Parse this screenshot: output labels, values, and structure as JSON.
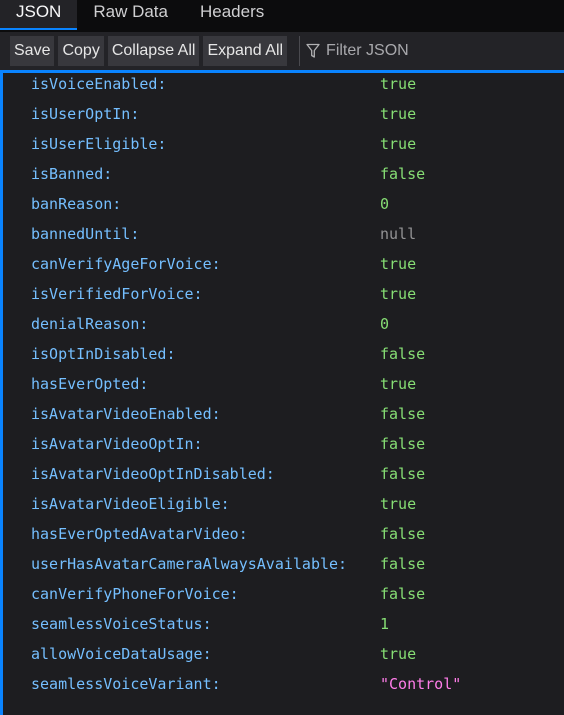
{
  "tabs": [
    {
      "label": "JSON",
      "active": true
    },
    {
      "label": "Raw Data",
      "active": false
    },
    {
      "label": "Headers",
      "active": false
    }
  ],
  "toolbar": {
    "save_label": "Save",
    "copy_label": "Copy",
    "collapse_label": "Collapse All",
    "expand_label": "Expand All",
    "filter_placeholder": "Filter JSON",
    "filter_icon": "funnel-icon"
  },
  "colors": {
    "key": "#75bfff",
    "boolean": "#86de74",
    "number": "#86de74",
    "null": "#939395",
    "string": "#ff7de9",
    "accent": "#0a84ff"
  },
  "rows": [
    {
      "key": "isVoiceEnabled:",
      "value": "true",
      "type": "bool"
    },
    {
      "key": "isUserOptIn:",
      "value": "true",
      "type": "bool"
    },
    {
      "key": "isUserEligible:",
      "value": "true",
      "type": "bool"
    },
    {
      "key": "isBanned:",
      "value": "false",
      "type": "bool"
    },
    {
      "key": "banReason:",
      "value": "0",
      "type": "num"
    },
    {
      "key": "bannedUntil:",
      "value": "null",
      "type": "null"
    },
    {
      "key": "canVerifyAgeForVoice:",
      "value": "true",
      "type": "bool"
    },
    {
      "key": "isVerifiedForVoice:",
      "value": "true",
      "type": "bool"
    },
    {
      "key": "denialReason:",
      "value": "0",
      "type": "num"
    },
    {
      "key": "isOptInDisabled:",
      "value": "false",
      "type": "bool"
    },
    {
      "key": "hasEverOpted:",
      "value": "true",
      "type": "bool"
    },
    {
      "key": "isAvatarVideoEnabled:",
      "value": "false",
      "type": "bool"
    },
    {
      "key": "isAvatarVideoOptIn:",
      "value": "false",
      "type": "bool"
    },
    {
      "key": "isAvatarVideoOptInDisabled:",
      "value": "false",
      "type": "bool"
    },
    {
      "key": "isAvatarVideoEligible:",
      "value": "true",
      "type": "bool"
    },
    {
      "key": "hasEverOptedAvatarVideo:",
      "value": "false",
      "type": "bool"
    },
    {
      "key": "userHasAvatarCameraAlwaysAvailable:",
      "value": "false",
      "type": "bool"
    },
    {
      "key": "canVerifyPhoneForVoice:",
      "value": "false",
      "type": "bool"
    },
    {
      "key": "seamlessVoiceStatus:",
      "value": "1",
      "type": "num"
    },
    {
      "key": "allowVoiceDataUsage:",
      "value": "true",
      "type": "bool"
    },
    {
      "key": "seamlessVoiceVariant:",
      "value": "\"Control\"",
      "type": "str"
    }
  ]
}
